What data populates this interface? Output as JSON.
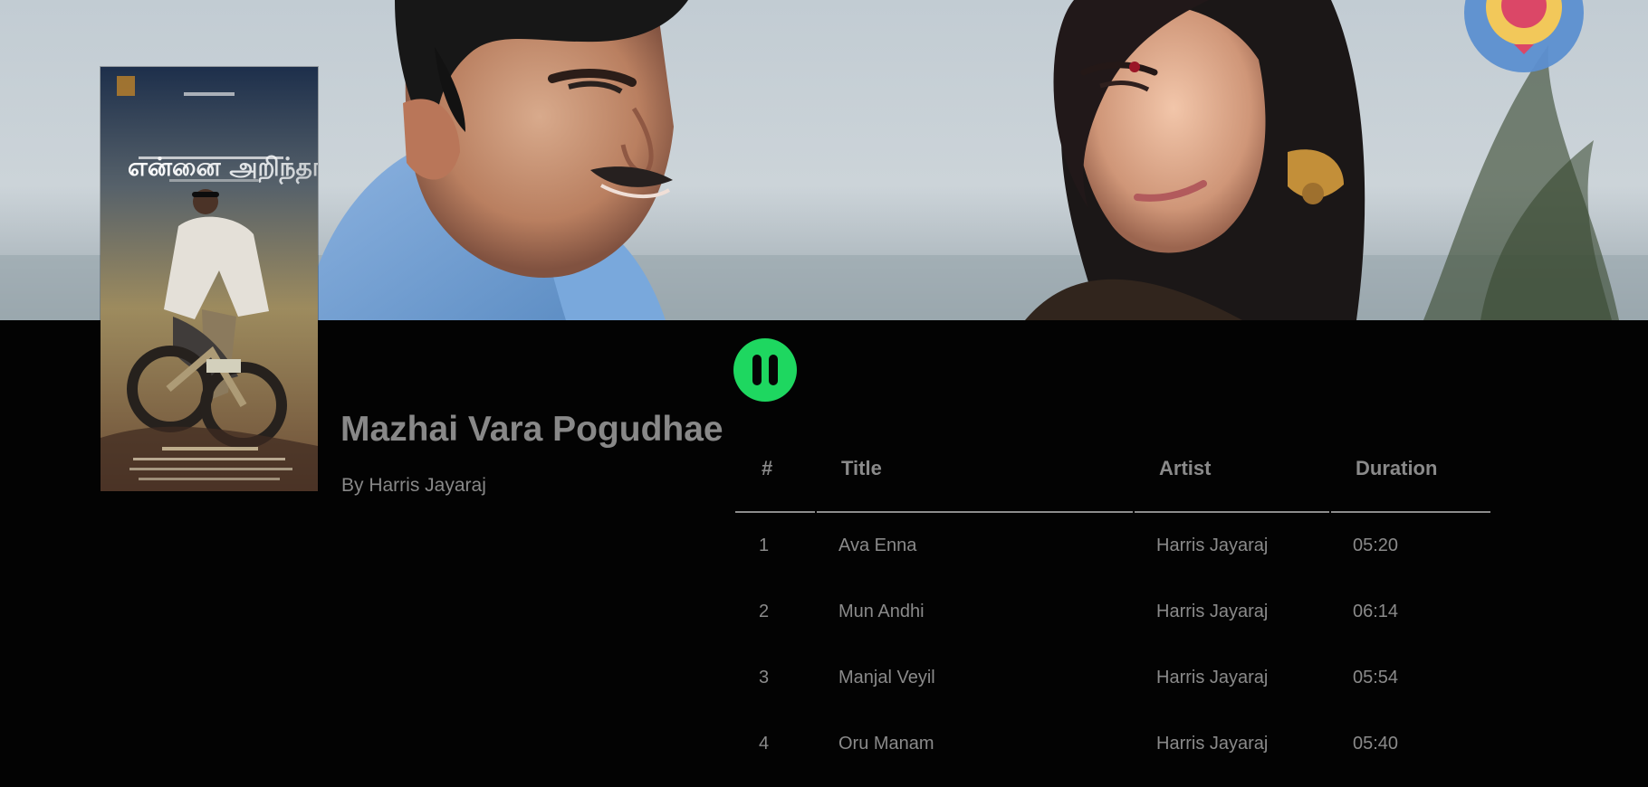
{
  "album": {
    "title": "Mazhai Vara Pogudhae",
    "artist": "By Harris Jayaraj",
    "poster": {
      "title_text": "என்னை அறிந்தால்..."
    }
  },
  "controls": {
    "playback_icon": "pause-icon",
    "accent_color": "#1ed760"
  },
  "tracklist": {
    "headers": {
      "number": "#",
      "title": "Title",
      "artist": "Artist",
      "duration": "Duration"
    },
    "tracks": [
      {
        "number": "1",
        "title": "Ava Enna",
        "artist": "Harris Jayaraj",
        "duration": "05:20"
      },
      {
        "number": "2",
        "title": "Mun Andhi",
        "artist": "Harris Jayaraj",
        "duration": "06:14"
      },
      {
        "number": "3",
        "title": "Manjal Veyil",
        "artist": "Harris Jayaraj",
        "duration": "05:54"
      },
      {
        "number": "4",
        "title": "Oru Manam",
        "artist": "Harris Jayaraj",
        "duration": "05:40"
      }
    ]
  }
}
